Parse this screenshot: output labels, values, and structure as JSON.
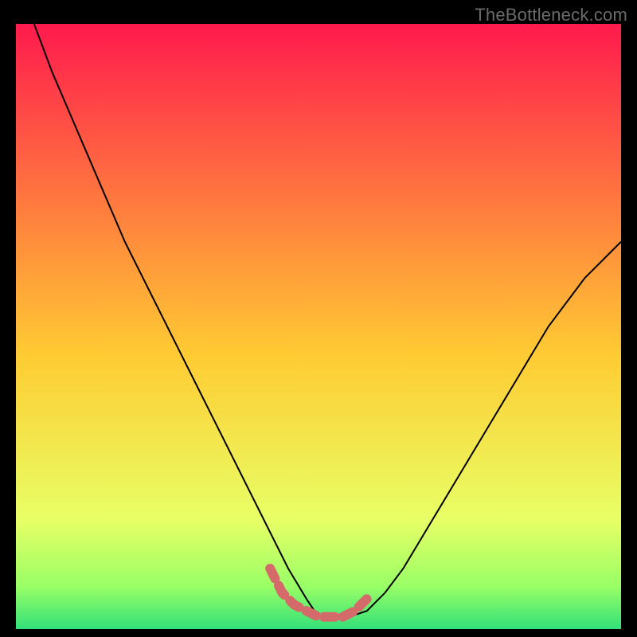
{
  "watermark": "TheBottleneck.com",
  "colors": {
    "black": "#000000",
    "curve": "#000000",
    "marker": "#d46a6a",
    "grad_top": "#ff1a4d",
    "grad_mid": "#ffcc33",
    "grad_low1": "#e8ff66",
    "grad_low2": "#99ff66",
    "grad_bot": "#33e07a"
  },
  "chart_data": {
    "type": "line",
    "title": "",
    "xlabel": "",
    "ylabel": "",
    "xlim": [
      0,
      100
    ],
    "ylim": [
      0,
      100
    ],
    "series": [
      {
        "name": "bottleneck-curve",
        "x": [
          3,
          6,
          9,
          12,
          15,
          18,
          21,
          24,
          27,
          30,
          33,
          36,
          39,
          42,
          45,
          48,
          50,
          52,
          55,
          58,
          61,
          64,
          67,
          70,
          73,
          76,
          79,
          82,
          85,
          88,
          91,
          94,
          97,
          100
        ],
        "y": [
          100,
          92,
          85,
          78,
          71,
          64,
          58,
          52,
          46,
          40,
          34,
          28,
          22,
          16,
          10,
          5,
          2,
          2,
          2,
          3,
          6,
          10,
          15,
          20,
          25,
          30,
          35,
          40,
          45,
          50,
          54,
          58,
          61,
          64
        ]
      }
    ],
    "markers": {
      "name": "highlight-segment",
      "x": [
        42,
        44,
        46,
        48,
        50,
        52,
        54,
        56,
        58
      ],
      "y": [
        10,
        6,
        4,
        3,
        2,
        2,
        2,
        3,
        5
      ]
    }
  }
}
